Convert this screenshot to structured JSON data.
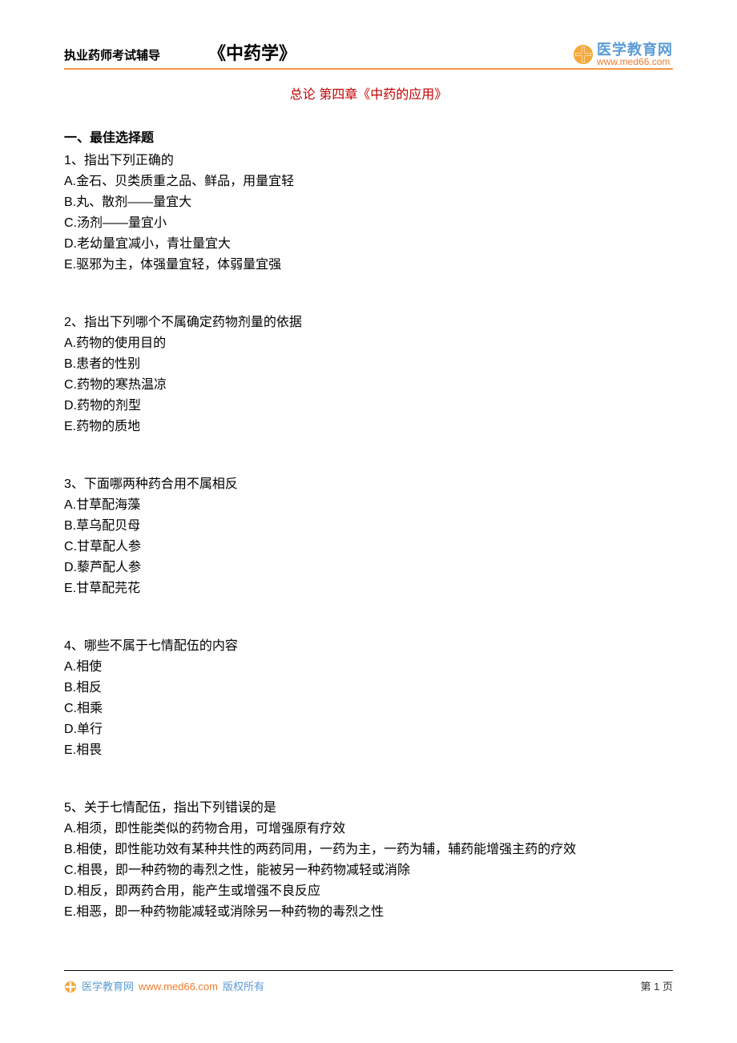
{
  "header": {
    "subtitle": "执业药师考试辅导",
    "title": "《中药学》",
    "logo": {
      "name": "医学教育网",
      "url": "www.med66.com"
    }
  },
  "chapter": "总论 第四章《中药的应用》",
  "sectionTitle": "一、最佳选择题",
  "questions": [
    {
      "stem": "1、指出下列正确的",
      "options": [
        "A.金石、贝类质重之品、鲜品，用量宜轻",
        "B.丸、散剂——量宜大",
        "C.汤剂——量宜小",
        "D.老幼量宜减小，青壮量宜大",
        "E.驱邪为主，体强量宜轻，体弱量宜强"
      ]
    },
    {
      "stem": "2、指出下列哪个不属确定药物剂量的依据",
      "options": [
        "A.药物的使用目的",
        "B.患者的性别",
        "C.药物的寒热温凉",
        "D.药物的剂型",
        "E.药物的质地"
      ]
    },
    {
      "stem": "3、下面哪两种药合用不属相反",
      "options": [
        "A.甘草配海藻",
        "B.草乌配贝母",
        "C.甘草配人参",
        "D.藜芦配人参",
        "E.甘草配芫花"
      ]
    },
    {
      "stem": "4、哪些不属于七情配伍的内容",
      "options": [
        "A.相使",
        "B.相反",
        "C.相乘",
        "D.单行",
        "E.相畏"
      ]
    },
    {
      "stem": "5、关于七情配伍，指出下列错误的是",
      "options": [
        "A.相须，即性能类似的药物合用，可增强原有疗效",
        "B.相使，即性能功效有某种共性的两药同用，一药为主，一药为辅，辅药能增强主药的疗效",
        "C.相畏，即一种药物的毒烈之性，能被另一种药物减轻或消除",
        "D.相反，即两药合用，能产生或增强不良反应",
        "E.相恶，即一种药物能减轻或消除另一种药物的毒烈之性"
      ]
    }
  ],
  "footer": {
    "brand": "医学教育网",
    "url": "www.med66.com",
    "copyright": "版权所有",
    "page": "第 1 页"
  }
}
